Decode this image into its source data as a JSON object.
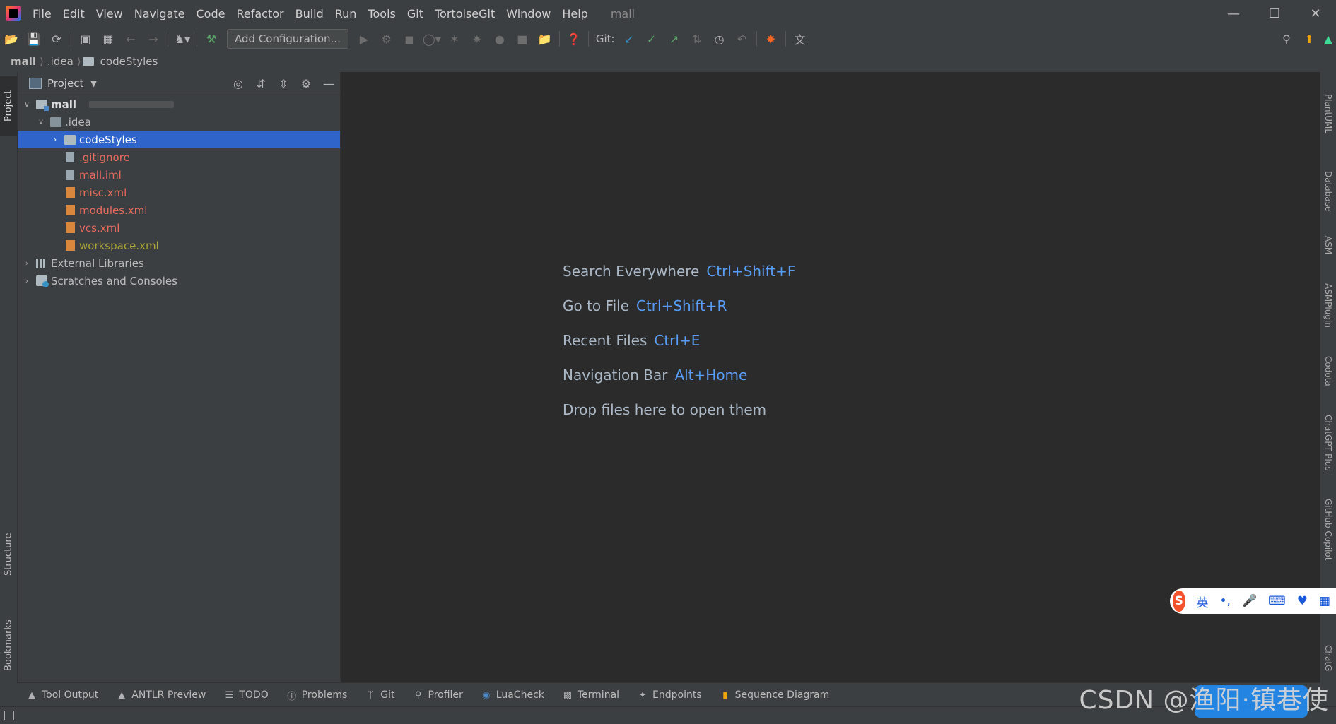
{
  "menubar": {
    "items": [
      "File",
      "Edit",
      "View",
      "Navigate",
      "Code",
      "Refactor",
      "Build",
      "Run",
      "Tools",
      "Git",
      "TortoiseGit",
      "Window",
      "Help"
    ],
    "project_title": "mall"
  },
  "toolbar": {
    "add_config_label": "Add Configuration...",
    "git_label": "Git:"
  },
  "navbar": {
    "crumbs": [
      "mall",
      ".idea",
      "codeStyles"
    ]
  },
  "left_stripe": {
    "project": "Project",
    "structure": "Structure",
    "bookmarks": "Bookmarks"
  },
  "right_stripe": [
    "PlantUML",
    "Database",
    "ASM",
    "ASMPlugin",
    "Codota",
    "ChatGPT-Plus",
    "GitHub Copilot",
    "ChatG"
  ],
  "project_panel": {
    "title": "Project",
    "tree": [
      {
        "label": "mall",
        "level": 0,
        "expanded": true,
        "kind": "module"
      },
      {
        "label": ".idea",
        "level": 1,
        "expanded": true,
        "kind": "folder"
      },
      {
        "label": "codeStyles",
        "level": 2,
        "expanded": false,
        "kind": "folder",
        "selected": true
      },
      {
        "label": ".gitignore",
        "level": 2,
        "kind": "file",
        "color": "red"
      },
      {
        "label": "mall.iml",
        "level": 2,
        "kind": "file",
        "color": "red"
      },
      {
        "label": "misc.xml",
        "level": 2,
        "kind": "xml",
        "color": "red"
      },
      {
        "label": "modules.xml",
        "level": 2,
        "kind": "xml",
        "color": "red"
      },
      {
        "label": "vcs.xml",
        "level": 2,
        "kind": "xml",
        "color": "red"
      },
      {
        "label": "workspace.xml",
        "level": 2,
        "kind": "xml",
        "color": "olive"
      },
      {
        "label": "External Libraries",
        "level": 0,
        "expanded": false,
        "kind": "lib"
      },
      {
        "label": "Scratches and Consoles",
        "level": 0,
        "expanded": false,
        "kind": "scratch"
      }
    ]
  },
  "welcome": [
    {
      "text": "Search Everywhere",
      "shortcut": "Ctrl+Shift+F"
    },
    {
      "text": "Go to File",
      "shortcut": "Ctrl+Shift+R"
    },
    {
      "text": "Recent Files",
      "shortcut": "Ctrl+E"
    },
    {
      "text": "Navigation Bar",
      "shortcut": "Alt+Home"
    },
    {
      "text": "Drop files here to open them",
      "shortcut": ""
    }
  ],
  "bottom_tabs": [
    "Tool Output",
    "ANTLR Preview",
    "TODO",
    "Problems",
    "Git",
    "Profiler",
    "LuaCheck",
    "Terminal",
    "Endpoints",
    "Sequence Diagram"
  ],
  "watermark": "CSDN @渔阳·镇巷使",
  "ime": {
    "lang": "英",
    "punct": "•,"
  },
  "colors": {
    "selection": "#2f65ca",
    "shortcut": "#589df6",
    "untracked": "#e86b5f",
    "ignored": "#a8a53a"
  }
}
